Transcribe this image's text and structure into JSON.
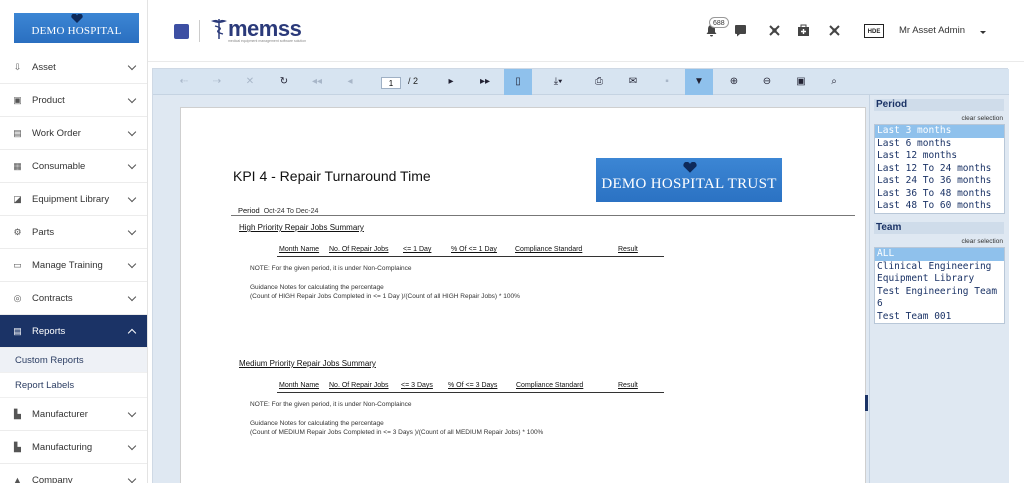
{
  "sidebar": {
    "logo_text": "DEMO HOSPITAL TRUST",
    "items": [
      {
        "label": "Asset",
        "icon": "asset-icon",
        "glyph": "⇩"
      },
      {
        "label": "Product",
        "icon": "product-icon",
        "glyph": "▣"
      },
      {
        "label": "Work Order",
        "icon": "work-order-icon",
        "glyph": "▤"
      },
      {
        "label": "Consumable",
        "icon": "consumable-icon",
        "glyph": "▦"
      },
      {
        "label": "Equipment Library",
        "icon": "equipment-library-icon",
        "glyph": "◪"
      },
      {
        "label": "Parts",
        "icon": "parts-icon",
        "glyph": "⚙"
      },
      {
        "label": "Manage Training",
        "icon": "training-icon",
        "glyph": "▭"
      },
      {
        "label": "Contracts",
        "icon": "contracts-icon",
        "glyph": "◎"
      },
      {
        "label": "Reports",
        "icon": "reports-icon",
        "glyph": "▤"
      }
    ],
    "sub_items": [
      {
        "label": "Custom Reports"
      },
      {
        "label": "Report Labels"
      }
    ],
    "items_after": [
      {
        "label": "Manufacturer",
        "icon": "manufacturer-icon",
        "glyph": "▙"
      },
      {
        "label": "Manufacturing",
        "icon": "manufacturing-icon",
        "glyph": "▙"
      },
      {
        "label": "Company",
        "icon": "company-icon",
        "glyph": "▲"
      }
    ]
  },
  "header": {
    "brand": "memss",
    "brand_sub": "medical equipment management software solution",
    "notification_count": "688",
    "user_initials": "HDE",
    "user_name": "Mr Asset Admin"
  },
  "toolbar": {
    "page_current": "1",
    "page_total": "/ 2"
  },
  "report": {
    "title": "KPI 4 - Repair Turnaround Time",
    "logo_text": "DEMO HOSPITAL TRUST",
    "period_label": "Period",
    "period_value": "Oct-24 To Dec-24",
    "high": {
      "title": "High Priority Repair Jobs Summary",
      "columns": [
        "Month Name",
        "No. Of Repair Jobs",
        "<= 1 Day",
        "% Of <= 1 Day",
        "Compliance Standard",
        "Result"
      ],
      "note": "NOTE: For the given period, it is under Non-Complaince",
      "guidance_title": "Guidance Notes for calculating the percentage",
      "guidance_formula": "(Count of HIGH Repair Jobs Completed in <= 1 Day )/(Count of all HIGH Repair Jobs) * 100%"
    },
    "medium": {
      "title": "Medium Priority Repair Jobs Summary",
      "columns": [
        "Month Name",
        "No. Of Repair Jobs",
        "<= 3 Days",
        "% Of <= 3 Days",
        "Compliance Standard",
        "Result"
      ],
      "note": "NOTE: For the given period, it is under Non-Complaince",
      "guidance_title": "Guidance Notes for calculating the percentage",
      "guidance_formula": "(Count of MEDIUM Repair Jobs Completed in <= 3 Days )/(Count of all MEDIUM Repair Jobs) * 100%"
    }
  },
  "params": {
    "period": {
      "title": "Period",
      "clear": "clear selection",
      "options": [
        "Last 3 months",
        "Last 6 months",
        "Last 12 months",
        "Last 12 To 24 months",
        "Last 24 To 36 months",
        "Last 36 To 48 months",
        "Last 48 To 60 months"
      ],
      "selected": "Last 3 months"
    },
    "team": {
      "title": "Team",
      "clear": "clear selection",
      "options": [
        "ALL",
        "Clinical Engineering",
        "Equipment Library",
        "Test Engineering Team",
        "6",
        "Test Team 001"
      ],
      "selected": "ALL"
    }
  },
  "colors": {
    "nav_active": "#1b3366",
    "toolbar_bg": "#d7e4f1",
    "selected": "#8fc1ec",
    "logo_blue": "#2f78c8"
  }
}
